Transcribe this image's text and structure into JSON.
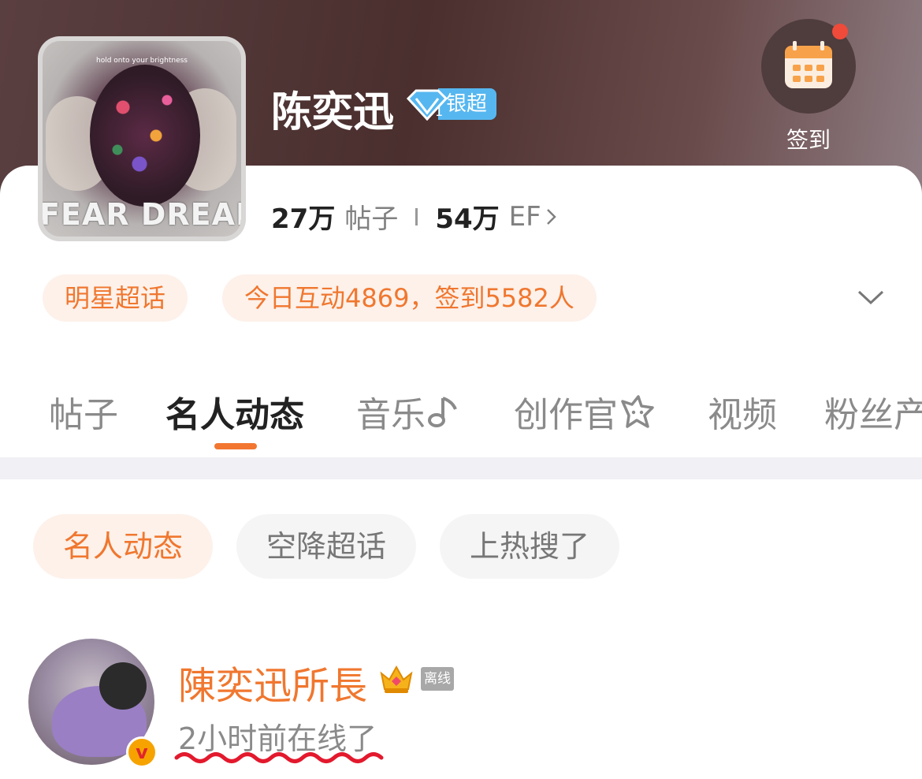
{
  "header": {
    "cover_top_text": "hold onto your brightness",
    "cover_title": "FEAR DREAMS",
    "name": "陈奕迅",
    "badge_label": "银超",
    "checkin_label": "签到"
  },
  "stats": {
    "posts_num": "27万",
    "posts_label": "帖子",
    "ef_num": "54万",
    "ef_label": "EF"
  },
  "tags": {
    "category": "明星超话",
    "activity": "今日互动4869，签到5582人"
  },
  "tabs": [
    "帖子",
    "名人动态",
    "音乐",
    "创作官",
    "视频",
    "粉丝产"
  ],
  "filters": [
    "名人动态",
    "空降超话",
    "上热搜了"
  ],
  "post": {
    "username": "陳奕迅所長",
    "offline_badge": "离线",
    "online_text": "2小时前在线了",
    "verified_badge": "v"
  },
  "colors": {
    "accent": "#f0772f",
    "badge_blue": "#56b7f0",
    "notify_red": "#f04a3a",
    "underline_red": "#e3192d"
  }
}
